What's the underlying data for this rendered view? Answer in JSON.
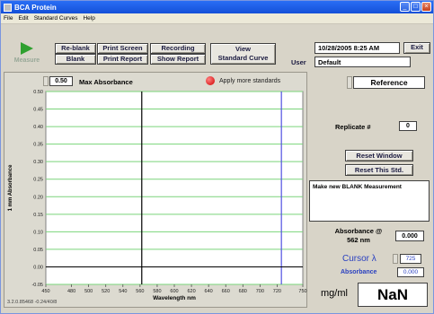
{
  "window": {
    "title": "BCA Protein",
    "min": "_",
    "max": "□",
    "close": "×"
  },
  "menu": [
    "File",
    "Edit",
    "Standard Curves",
    "Help"
  ],
  "toolbar": {
    "measure": "Measure",
    "reblank": "Re-blank",
    "blank": "Blank",
    "print_screen": "Print Screen",
    "print_report": "Print Report",
    "recording": "Recording",
    "show_report": "Show Report",
    "view_line1": "View",
    "view_line2": "Standard Curve",
    "datetime": "10/28/2005  8:25 AM",
    "exit": "Exit",
    "user_label": "User",
    "user_value": "Default"
  },
  "plot_controls": {
    "max_value": "0.50",
    "max_label": "Max  Absorbance",
    "apply_label": "Apply more standards",
    "indicator_color": "#d00000"
  },
  "chart_data": {
    "type": "line",
    "xlabel": "Wavelength nm",
    "ylabel": "1 mm Absorbance",
    "xlim": [
      450,
      750
    ],
    "ylim": [
      -0.05,
      0.5
    ],
    "x_ticks": [
      "450",
      "480",
      "500",
      "520",
      "540",
      "560",
      "580",
      "600",
      "620",
      "640",
      "660",
      "680",
      "700",
      "720",
      "750"
    ],
    "y_ticks": [
      "0.50",
      "0.45",
      "0.40",
      "0.35",
      "0.30",
      "0.25",
      "0.20",
      "0.15",
      "0.10",
      "0.05",
      "0.00",
      "-0.05"
    ],
    "grid": true,
    "grid_color": "#7ad47a",
    "markers": [
      {
        "x": 562,
        "color": "#000000"
      },
      {
        "x": 725,
        "color": "#5050e0"
      }
    ],
    "series": [
      {
        "x": [
          450,
          500,
          550,
          600,
          650,
          700,
          750
        ],
        "y": [
          0.0,
          0.0,
          0.0,
          0.0,
          0.0,
          0.0,
          0.0
        ],
        "color": "#000000"
      }
    ]
  },
  "footer": "3.2.0.85468 -0.24/40/8",
  "right": {
    "reference": "Reference",
    "replicate_label": "Replicate #",
    "replicate_value": "0",
    "reset_window": "Reset Window",
    "reset_std": "Reset This Std.",
    "message": "Make new BLANK Measurement",
    "abs_label_line1": "Absorbance @",
    "abs_label_line2": "562 nm",
    "abs_value": "0.000",
    "cursor_label": "Cursor λ",
    "cursor_value": "725",
    "abs2_label": "Absorbance",
    "abs2_value": "0.000",
    "unit": "mg/ml",
    "result": "NaN"
  }
}
